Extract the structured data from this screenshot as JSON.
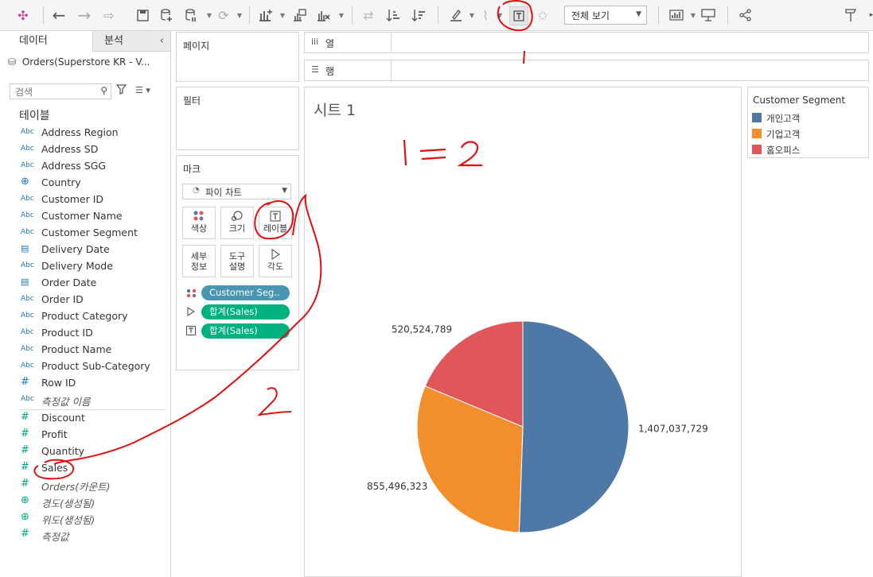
{
  "toolbar": {
    "icons": [
      "tableau-logo-icon",
      "back-icon",
      "forward-icon",
      "redo-icon",
      "save-icon",
      "new-datasource-icon",
      "pause-icon",
      "refresh-icon",
      "new-worksheet-icon",
      "duplicate-icon",
      "clear-icon",
      "swap-icon",
      "sort-asc-icon",
      "sort-desc-icon",
      "highlight-icon",
      "paperclip-icon",
      "show-labels-icon",
      "pin-icon",
      "show-me-icon",
      "presentation-icon",
      "share-icon",
      "pin-sheet-icon"
    ],
    "view_select": "전체 보기"
  },
  "data_pane": {
    "tab_data": "데이터",
    "tab_analysis": "분석",
    "datasource": "Orders(Superstore KR - V...",
    "search_placeholder": "검색",
    "tables_title": "테이블",
    "dimensions": [
      {
        "type": "Abc",
        "name": "Address Region"
      },
      {
        "type": "Abc",
        "name": "Address SD"
      },
      {
        "type": "Abc",
        "name": "Address SGG"
      },
      {
        "type": "globe",
        "name": "Country"
      },
      {
        "type": "Abc",
        "name": "Customer ID"
      },
      {
        "type": "Abc",
        "name": "Customer Name"
      },
      {
        "type": "Abc",
        "name": "Customer Segment"
      },
      {
        "type": "date",
        "name": "Delivery Date"
      },
      {
        "type": "Abc",
        "name": "Delivery Mode"
      },
      {
        "type": "date",
        "name": "Order Date"
      },
      {
        "type": "Abc",
        "name": "Order ID"
      },
      {
        "type": "Abc",
        "name": "Product Category"
      },
      {
        "type": "Abc",
        "name": "Product ID"
      },
      {
        "type": "Abc",
        "name": "Product Name"
      },
      {
        "type": "Abc",
        "name": "Product Sub-Category"
      },
      {
        "type": "#",
        "name": "Row ID"
      },
      {
        "type": "Abc",
        "name": "측정값 이름",
        "italic": true
      }
    ],
    "measures": [
      {
        "type": "#",
        "name": "Discount"
      },
      {
        "type": "#",
        "name": "Profit"
      },
      {
        "type": "#",
        "name": "Quantity"
      },
      {
        "type": "#",
        "name": "Sales"
      },
      {
        "type": "#",
        "name": "Orders(카운트)",
        "italic": true
      },
      {
        "type": "globe",
        "name": "경도(생성됨)",
        "italic": true
      },
      {
        "type": "globe",
        "name": "위도(생성됨)",
        "italic": true
      },
      {
        "type": "#",
        "name": "측정값",
        "italic": true
      }
    ]
  },
  "shelves": {
    "pages": "페이지",
    "filters": "필터",
    "marks": "마크",
    "columns": "열",
    "rows": "행"
  },
  "marks": {
    "mark_type": "파이 차트",
    "buttons": {
      "color": "색상",
      "size": "크기",
      "label": "레이블",
      "detail_1": "세부",
      "detail_2": "정보",
      "tooltip_1": "도구",
      "tooltip_2": "설명",
      "angle": "각도"
    },
    "pills": [
      {
        "icon": "color",
        "text": "Customer Seg..",
        "color": "#4996b2"
      },
      {
        "icon": "angle",
        "text": "합계(Sales)",
        "color": "#00b180"
      },
      {
        "icon": "label",
        "text": "합계(Sales)",
        "color": "#00b180"
      }
    ]
  },
  "sheet_title": "시트 1",
  "legend": {
    "title": "Customer Segment",
    "items": [
      {
        "label": "개인고객",
        "color": "#4e79a7"
      },
      {
        "label": "기업고객",
        "color": "#f28e2b"
      },
      {
        "label": "홈오피스",
        "color": "#e15759"
      }
    ]
  },
  "chart_data": {
    "type": "pie",
    "title": "시트 1",
    "slices": [
      {
        "name": "개인고객",
        "value": 1407037729,
        "label": "1,407,037,729",
        "color": "#4e79a7"
      },
      {
        "name": "기업고객",
        "value": 855496323,
        "label": "855,496,323",
        "color": "#f28e2b"
      },
      {
        "name": "홈오피스",
        "value": 520524789,
        "label": "520,524,789",
        "color": "#e15759"
      }
    ]
  },
  "annotations": {
    "note_1": "1 = 2",
    "note_2": "2"
  }
}
